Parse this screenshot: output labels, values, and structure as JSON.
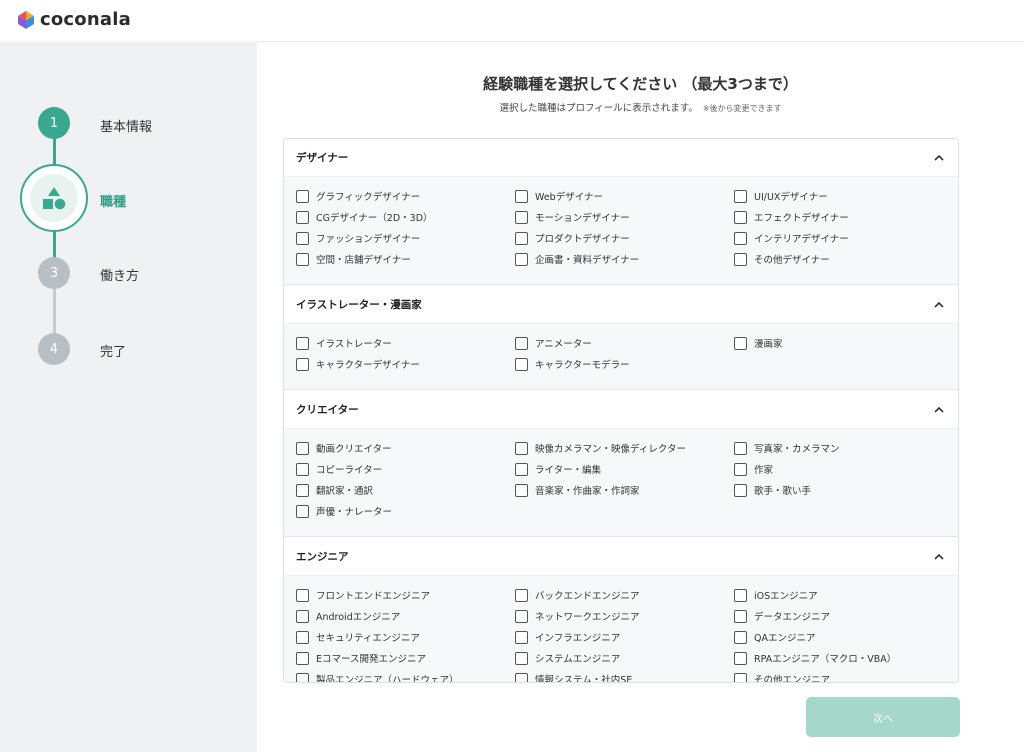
{
  "brand": {
    "name": "coconala"
  },
  "sidebar": {
    "steps": [
      {
        "number": "1",
        "label": "基本情報",
        "status": "done"
      },
      {
        "number": "",
        "label": "職種",
        "status": "current"
      },
      {
        "number": "3",
        "label": "働き方",
        "status": "pending"
      },
      {
        "number": "4",
        "label": "完了",
        "status": "pending"
      }
    ]
  },
  "main": {
    "title": "経験職種を選択してください （最大3つまで）",
    "subtitle": "選択した職種はプロフィールに表示されます。",
    "note": "※後から変更できます"
  },
  "sections": [
    {
      "title": "デザイナー",
      "options": [
        [
          "グラフィックデザイナー",
          "Webデザイナー",
          "UI/UXデザイナー"
        ],
        [
          "CGデザイナー（2D・3D）",
          "モーションデザイナー",
          "エフェクトデザイナー"
        ],
        [
          "ファッションデザイナー",
          "プロダクトデザイナー",
          "インテリアデザイナー"
        ],
        [
          "空間・店舗デザイナー",
          "企画書・資料デザイナー",
          "その他デザイナー"
        ]
      ]
    },
    {
      "title": "イラストレーター・漫画家",
      "options": [
        [
          "イラストレーター",
          "アニメーター",
          "漫画家"
        ],
        [
          "キャラクターデザイナー",
          "キャラクターモデラー"
        ]
      ]
    },
    {
      "title": "クリエイター",
      "options": [
        [
          "動画クリエイター",
          "映像カメラマン・映像ディレクター",
          "写真家・カメラマン"
        ],
        [
          "コピーライター",
          "ライター・編集",
          "作家"
        ],
        [
          "翻訳家・通訳",
          "音楽家・作曲家・作詞家",
          "歌手・歌い手"
        ],
        [
          "声優・ナレーター"
        ]
      ]
    },
    {
      "title": "エンジニア",
      "options": [
        [
          "フロントエンドエンジニア",
          "バックエンドエンジニア",
          "iOSエンジニア"
        ],
        [
          "Androidエンジニア",
          "ネットワークエンジニア",
          "データエンジニア"
        ],
        [
          "セキュリティエンジニア",
          "インフラエンジニア",
          "QAエンジニア"
        ],
        [
          "Eコマース開発エンジニア",
          "システムエンジニア",
          "RPAエンジニア（マクロ・VBA）"
        ],
        [
          "製品エンジニア（ハードウェア）",
          "情報システム・社内SE",
          "その他エンジニア"
        ]
      ]
    }
  ],
  "footer": {
    "next_label": "次へ"
  },
  "colors": {
    "accent": "#3aa88f",
    "button_disabled": "#a5d8cb",
    "sidebar_bg": "#eff1f3"
  }
}
